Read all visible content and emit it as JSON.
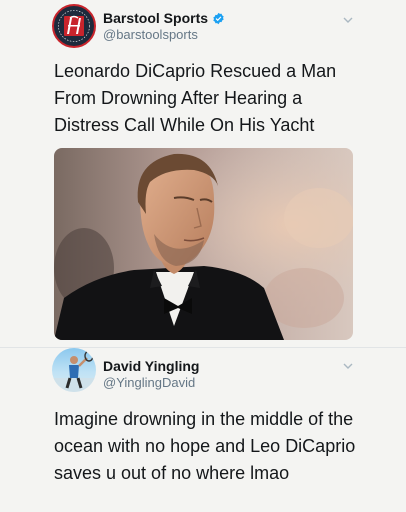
{
  "tweet1": {
    "name": "Barstool Sports",
    "handle": "@barstoolsports",
    "text": "Leonardo DiCaprio Rescued a Man\nFrom Drowning After Hearing a\nDistress Call While On His Yacht",
    "avatar_logo_text": "BARSTOOL SPORTS",
    "avatar_icon": "barstool-logo-icon",
    "photo_icon": "man-in-tuxedo-photo",
    "verified_icon": "verified-badge-icon",
    "menu_icon": "chevron-down-icon"
  },
  "tweet2": {
    "name": "David Yingling",
    "handle": "@YinglingDavid",
    "text": "Imagine drowning in the middle of the\nocean with no hope and Leo DiCaprio\nsaves u out of no where lmao",
    "avatar_icon": "tennis-player-avatar",
    "menu_icon": "chevron-down-icon"
  },
  "colors": {
    "verified_blue": "#1da1f2",
    "handle_gray": "#657786",
    "barstool_red": "#c8242c",
    "barstool_navy": "#1e2a3c"
  }
}
